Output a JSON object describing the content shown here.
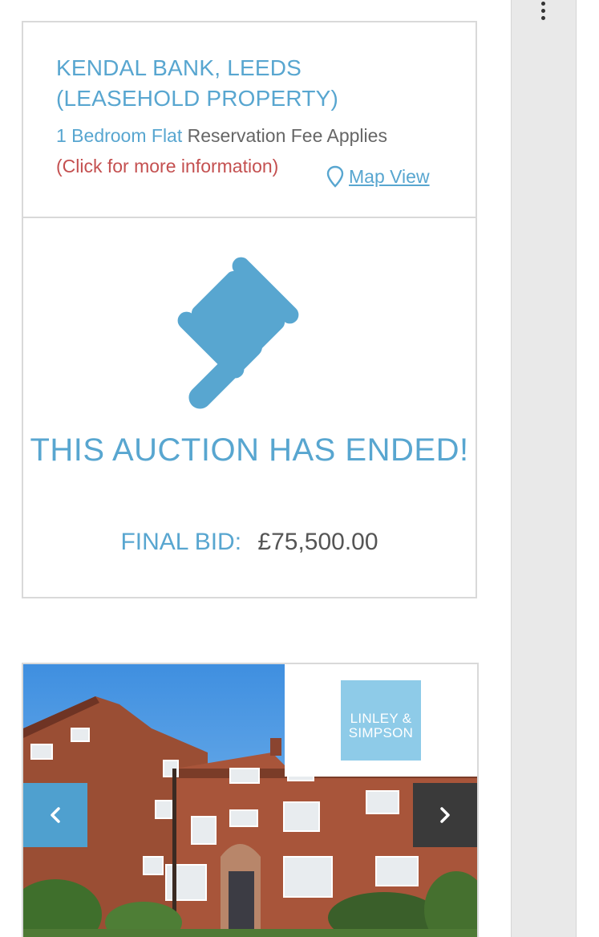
{
  "property": {
    "title": "KENDAL BANK, LEEDS (LEASEHOLD PROPERTY)",
    "type": "1 Bedroom Flat",
    "fee_note": "Reservation Fee Applies",
    "more_info_link": "(Click for more information)",
    "map_view_label": "Map View"
  },
  "auction": {
    "status_text": "THIS AUCTION HAS ENDED!",
    "final_bid_label": "FINAL BID:",
    "final_bid_value": "£75,500.00",
    "icon": "gavel-icon"
  },
  "carousel": {
    "agent_logo_line1": "LINLEY &",
    "agent_logo_line2": "SIMPSON",
    "prev_icon": "chevron-left-icon",
    "next_icon": "chevron-right-icon"
  },
  "colors": {
    "accent": "#58a6d0",
    "link_red": "#c45050",
    "text_gray": "#666666",
    "border": "#d9d9d9",
    "prev_button": "#4fa0cf",
    "next_button": "#3a3a3a",
    "logo_bg": "#8ecbe8"
  }
}
